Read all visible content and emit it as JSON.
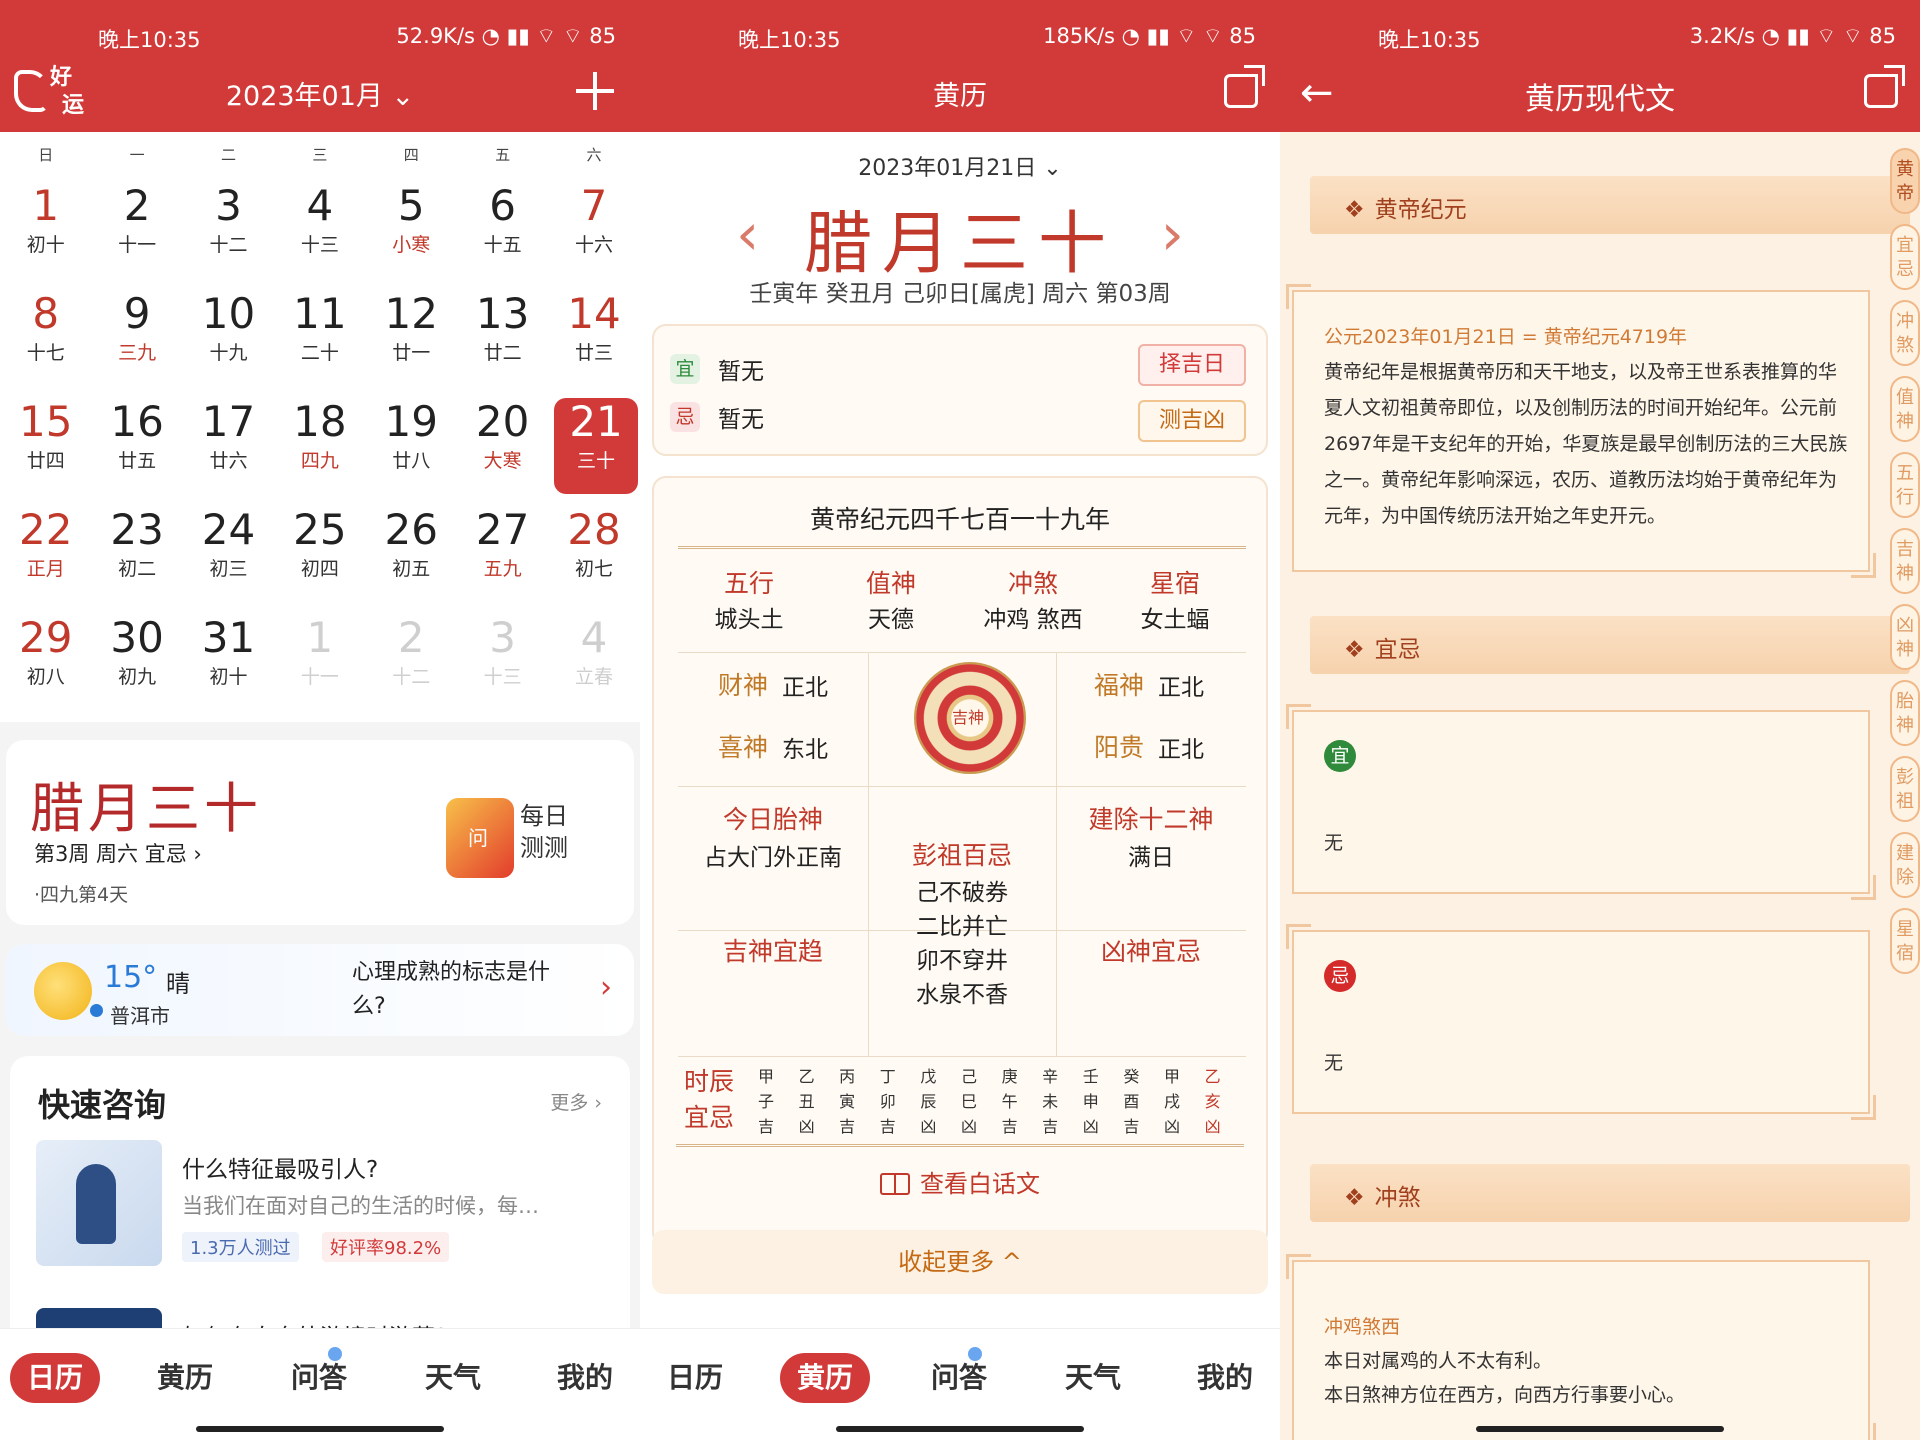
{
  "status": {
    "p1": {
      "time": "晚上10:35",
      "net": "52.9K/s"
    },
    "p2": {
      "time": "晚上10:35",
      "net": "185K/s"
    },
    "p3": {
      "time": "晚上10:35",
      "net": "3.2K/s"
    },
    "battery": "85"
  },
  "calendar": {
    "logo_line1": "好",
    "logo_line2": "运",
    "month_title": "2023年01月",
    "weekdays": [
      "日",
      "一",
      "二",
      "三",
      "四",
      "五",
      "六"
    ],
    "days": [
      {
        "d": "1",
        "l": "初十"
      },
      {
        "d": "2",
        "l": "十一"
      },
      {
        "d": "3",
        "l": "十二"
      },
      {
        "d": "4",
        "l": "十三"
      },
      {
        "d": "5",
        "l": "小寒"
      },
      {
        "d": "6",
        "l": "十五"
      },
      {
        "d": "7",
        "l": "十六"
      },
      {
        "d": "8",
        "l": "十七"
      },
      {
        "d": "9",
        "l": "三九"
      },
      {
        "d": "10",
        "l": "十九"
      },
      {
        "d": "11",
        "l": "二十"
      },
      {
        "d": "12",
        "l": "廿一"
      },
      {
        "d": "13",
        "l": "廿二"
      },
      {
        "d": "14",
        "l": "廿三"
      },
      {
        "d": "15",
        "l": "廿四"
      },
      {
        "d": "16",
        "l": "廿五"
      },
      {
        "d": "17",
        "l": "廿六"
      },
      {
        "d": "18",
        "l": "四九"
      },
      {
        "d": "19",
        "l": "廿八"
      },
      {
        "d": "20",
        "l": "大寒"
      },
      {
        "d": "21",
        "l": "三十"
      },
      {
        "d": "22",
        "l": "正月"
      },
      {
        "d": "23",
        "l": "初二"
      },
      {
        "d": "24",
        "l": "初三"
      },
      {
        "d": "25",
        "l": "初四"
      },
      {
        "d": "26",
        "l": "初五"
      },
      {
        "d": "27",
        "l": "五九"
      },
      {
        "d": "28",
        "l": "初七"
      },
      {
        "d": "29",
        "l": "初八"
      },
      {
        "d": "30",
        "l": "初九"
      },
      {
        "d": "31",
        "l": "初十"
      },
      {
        "d": "1",
        "l": "十一"
      },
      {
        "d": "2",
        "l": "十二"
      },
      {
        "d": "3",
        "l": "十三"
      },
      {
        "d": "4",
        "l": "立春"
      }
    ],
    "lunar_title": "腊月三十",
    "lunar_sub": "第3周 周六 宜忌",
    "lunar_sub2": "·四九第4天",
    "daily_line1": "每日",
    "daily_line2": "测测",
    "tube_char": "问"
  },
  "weather": {
    "temp": "15°",
    "cond": "晴",
    "city": "普洱市",
    "question": "心理成熟的标志是什么?"
  },
  "consult": {
    "title": "快速咨询",
    "more": "更多",
    "item1_title": "什么特征最吸引人?",
    "item1_desc": "当我们在面对自己的生活的时候，每…",
    "tag1": "1.3万人测过",
    "tag2": "好评率98.2%",
    "item2_title": "如何在自身外游境时游藏?"
  },
  "tabs": [
    "日历",
    "黄历",
    "问答",
    "天气",
    "我的"
  ],
  "almanac": {
    "title": "黄历",
    "date": "2023年01月21日",
    "lunar": "腊月三十",
    "ganzhi": "壬寅年 癸丑月 己卯日[属虎] 周六 第03周",
    "yi_label": "宜",
    "ji_label": "忌",
    "yi_text": "暂无",
    "ji_text": "暂无",
    "btn_zeji": "择吉日",
    "btn_ceji": "测吉凶",
    "hd_title": "黄帝纪元四千七百一十九年",
    "cats": [
      {
        "k": "五行",
        "v": "城头土"
      },
      {
        "k": "值神",
        "v": "天德"
      },
      {
        "k": "冲煞",
        "v": "冲鸡 煞西"
      },
      {
        "k": "星宿",
        "v": "女土蝠"
      }
    ],
    "caishen_k": "财神",
    "caishen_v": "正北",
    "xishen_k": "喜神",
    "xishen_v": "东北",
    "fushen_k": "福神",
    "fushen_v": "正北",
    "yanggui_k": "阳贵",
    "yanggui_v": "正北",
    "compass_center": "吉神",
    "taishen_k": "今日胎神",
    "taishen_v": "占大门外正南",
    "jianchu_k": "建除十二神",
    "jianchu_v": "满日",
    "pengzu_k": "彭祖百忌",
    "pengzu_lines": [
      "己不破券",
      "二比并亡",
      "卯不穿井",
      "水泉不香"
    ],
    "jishen_k": "吉神宜趋",
    "xiongshen_k": "凶神宜忌",
    "shichen_title1": "时辰",
    "shichen_title2": "宜忌",
    "shichen": [
      {
        "a": "甲",
        "b": "子",
        "c": "吉"
      },
      {
        "a": "乙",
        "b": "丑",
        "c": "凶"
      },
      {
        "a": "丙",
        "b": "寅",
        "c": "吉"
      },
      {
        "a": "丁",
        "b": "卯",
        "c": "吉"
      },
      {
        "a": "戊",
        "b": "辰",
        "c": "凶"
      },
      {
        "a": "己",
        "b": "巳",
        "c": "凶"
      },
      {
        "a": "庚",
        "b": "午",
        "c": "吉"
      },
      {
        "a": "辛",
        "b": "未",
        "c": "吉"
      },
      {
        "a": "壬",
        "b": "申",
        "c": "凶"
      },
      {
        "a": "癸",
        "b": "酉",
        "c": "吉"
      },
      {
        "a": "甲",
        "b": "戌",
        "c": "凶"
      },
      {
        "a": "乙",
        "b": "亥",
        "c": "凶"
      }
    ],
    "baihua": "查看白话文",
    "collapse": "收起更多 ^"
  },
  "modern": {
    "title": "黄历现代文",
    "sec1": "黄帝纪元",
    "sec1_date": "公元2023年01月21日 = 黄帝纪元4719年",
    "sec1_para": "黄帝纪年是根据黄帝历和天干地支，以及帝王世系表推算的华夏人文初祖黄帝即位，以及创制历法的时间开始纪年。公元前2697年是干支纪年的开始，华夏族是最早创制历法的三大民族之一。黄帝纪年影响深远，农历、道教历法均始于黄帝纪年为元年，为中国传统历法开始之年史开元。",
    "sec2": "宜忌",
    "yi_badge": "宜",
    "yi_text": "无",
    "ji_badge": "忌",
    "ji_text": "无",
    "sec3": "冲煞",
    "chongsha": "冲鸡煞西",
    "cs_line1": "本日对属鸡的人不太有利。",
    "cs_line2": "本日煞神方位在西方，向西方行事要小心。",
    "side_tabs": [
      "黄帝",
      "宜忌",
      "冲煞",
      "值神",
      "五行",
      "吉神",
      "凶神",
      "胎神",
      "彭祖",
      "建除",
      "星宿"
    ]
  }
}
